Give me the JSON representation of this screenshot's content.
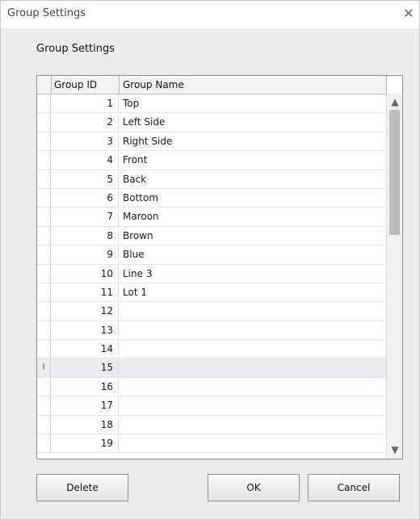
{
  "window": {
    "title": "Group Settings"
  },
  "section": {
    "label": "Group Settings"
  },
  "grid": {
    "columns": [
      "Group ID",
      "Group Name"
    ],
    "rows": [
      {
        "id": "1",
        "name": "Top"
      },
      {
        "id": "2",
        "name": "Left Side"
      },
      {
        "id": "3",
        "name": "Right Side"
      },
      {
        "id": "4",
        "name": "Front"
      },
      {
        "id": "5",
        "name": "Back"
      },
      {
        "id": "6",
        "name": "Bottom"
      },
      {
        "id": "7",
        "name": "Maroon"
      },
      {
        "id": "8",
        "name": "Brown"
      },
      {
        "id": "9",
        "name": "Blue"
      },
      {
        "id": "10",
        "name": "Line 3"
      },
      {
        "id": "11",
        "name": "Lot 1"
      },
      {
        "id": "12",
        "name": ""
      },
      {
        "id": "13",
        "name": ""
      },
      {
        "id": "14",
        "name": ""
      },
      {
        "id": "15",
        "name": "",
        "row_marker": "I"
      },
      {
        "id": "16",
        "name": ""
      },
      {
        "id": "17",
        "name": ""
      },
      {
        "id": "18",
        "name": ""
      },
      {
        "id": "19",
        "name": ""
      }
    ],
    "selected_row_index": 14
  },
  "buttons": {
    "delete": "Delete",
    "ok": "OK",
    "cancel": "Cancel"
  },
  "icons": {
    "close": "close-icon",
    "scroll_up": "arrow-up-icon",
    "scroll_down": "arrow-down-icon"
  },
  "colors": {
    "dialog_bg": "#ececec",
    "selected_row": "#e9edf2",
    "grid_border": "#8f8f8f"
  }
}
